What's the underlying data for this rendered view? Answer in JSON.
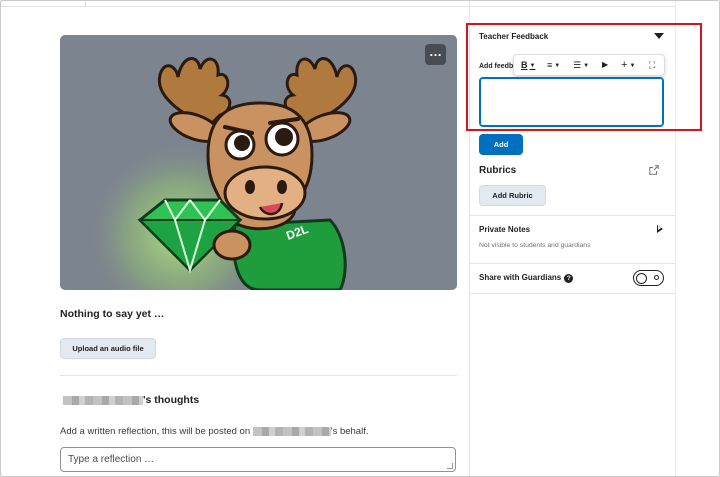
{
  "image_card": {
    "alt": "D2L moose mascot holding a green gem",
    "more_label": "…"
  },
  "audio": {
    "empty_text": "Nothing to say yet …",
    "upload_label": "Upload an audio file"
  },
  "reflection": {
    "heading_suffix": "'s thoughts",
    "instruction_prefix": "Add a written reflection, this will be posted on",
    "instruction_suffix": "'s behalf.",
    "placeholder": "Type a reflection …"
  },
  "teacher_feedback": {
    "title": "Teacher Feedback",
    "add_feedback_label": "Add feedba",
    "toolbar": {
      "bold": "B",
      "align": "≡",
      "list": "☰",
      "media": "▶",
      "insert": "+",
      "fullscreen": "⛶"
    },
    "add_button": "Add"
  },
  "rubrics": {
    "title": "Rubrics",
    "add_button": "Add Rubric"
  },
  "private_notes": {
    "title": "Private Notes",
    "subtitle": "Not visible to students and guardians"
  },
  "share": {
    "title": "Share with Guardians",
    "help": "?"
  },
  "colors": {
    "primary": "#006fbf",
    "highlight": "#d4161b",
    "secondary_button": "#e3e9f1"
  }
}
